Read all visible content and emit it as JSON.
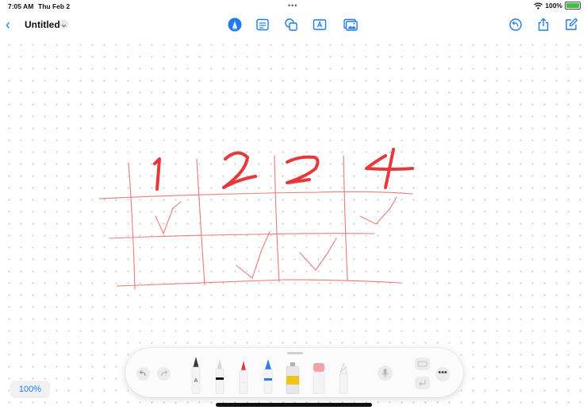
{
  "status": {
    "time": "7:05 AM",
    "date": "Thu Feb 2",
    "battery": "100%"
  },
  "toolbar": {
    "title": "Untitled"
  },
  "canvas": {
    "numbers": [
      "1",
      "2",
      "3",
      "4"
    ]
  },
  "palette": {
    "tools": [
      "pen",
      "monoline",
      "marker",
      "crayon",
      "fountain-pen",
      "eraser",
      "lasso"
    ]
  },
  "zoom": {
    "label": "100%"
  },
  "colors": {
    "accent": "#1e7cf2",
    "ink": "#e8393a",
    "gridline": "#ec7a7a"
  }
}
